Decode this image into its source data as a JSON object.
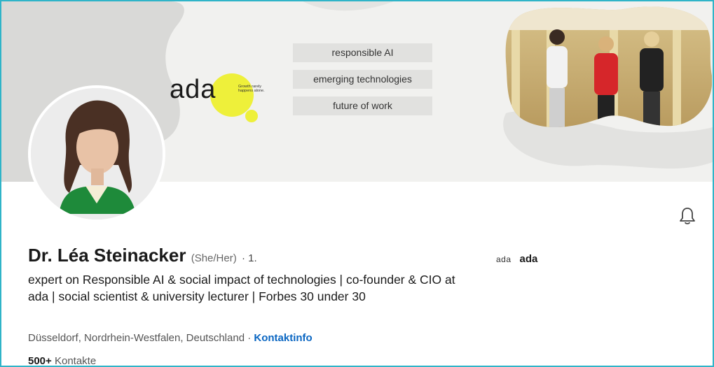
{
  "banner": {
    "logo_text": "ada",
    "logo_tagline": "Growth rarely happens alone.",
    "tags": [
      "responsible AI",
      "emerging technologies",
      "future of work"
    ]
  },
  "profile": {
    "name": "Dr. Léa Steinacker",
    "pronouns": "(She/Her)",
    "degree": "· 1.",
    "headline": "expert on Responsible AI & social impact of technologies | co-founder & CIO at ada | social scientist & university lecturer | Forbes 30 under 30",
    "location": "Düsseldorf, Nordrhein-Westfalen, Deutschland",
    "separator": "·",
    "contact_info_label": "Kontaktinfo",
    "connections_count": "500+",
    "connections_label": "Kontakte"
  },
  "company": {
    "logo_text": "ada",
    "name": "ada"
  },
  "icons": {
    "notification": "bell-icon"
  },
  "colors": {
    "accent_link": "#0a66c2",
    "logo_yellow": "#eef03a",
    "frame": "#2fb4c8"
  }
}
